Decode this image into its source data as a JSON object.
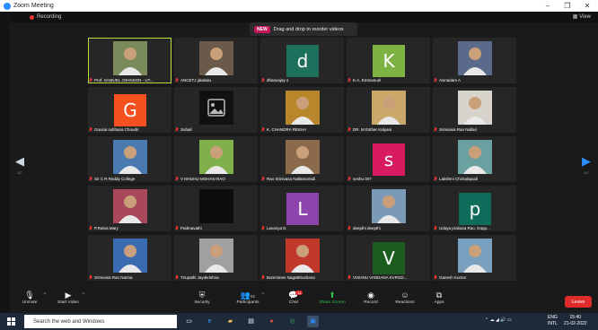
{
  "window": {
    "title": "Zoom Meeting"
  },
  "status": {
    "recording": "Recording",
    "view": "View"
  },
  "banner": {
    "badge": "NEW",
    "text": "Drag and drop to reorder videos"
  },
  "pager": {
    "left": "1/2",
    "right": "1/2"
  },
  "participants": [
    {
      "name": "Prof. SAMUEL JOHNSON - UT...",
      "type": "photo",
      "active": true,
      "color": "#7a8a5a"
    },
    {
      "name": "ANCETJ jalakalu",
      "type": "photo",
      "color": "#6b5a4a"
    },
    {
      "name": "dhanunjay s",
      "type": "letter",
      "letter": "d",
      "color": "#1e6f5c"
    },
    {
      "name": "K.A. Emmanuel",
      "type": "letter",
      "letter": "K",
      "color": "#7cb342"
    },
    {
      "name": "Asinadam A",
      "type": "photo",
      "color": "#5a6a8a"
    },
    {
      "name": "Gousia sulthana Choudri",
      "type": "letter",
      "letter": "G",
      "color": "#f4511e"
    },
    {
      "name": "Suhail",
      "type": "image-icon",
      "color": "#111111"
    },
    {
      "name": "K. CHANDRA REKHA",
      "type": "photo",
      "color": "#b8862b"
    },
    {
      "name": "DR. M Esther Kalyani",
      "type": "photo",
      "color": "#c9a86a"
    },
    {
      "name": "Srinivasa Rao Nallari",
      "type": "photo",
      "color": "#d7d2cc"
    },
    {
      "name": "Sir C R Reddy College",
      "type": "photo",
      "color": "#4a7ab0"
    },
    {
      "name": "V MADHU MOHAN RAO",
      "type": "photo",
      "color": "#7fb04a"
    },
    {
      "name": "Rao Srinivasa Nallamamidi",
      "type": "photo",
      "color": "#8a6a4a"
    },
    {
      "name": "seshu 007",
      "type": "letter",
      "letter": "s",
      "color": "#d81b60"
    },
    {
      "name": "Lakshmi Chintalapudi",
      "type": "photo",
      "color": "#6aa0a0"
    },
    {
      "name": "P.Ratna Mary",
      "type": "photo",
      "color": "#a8485a"
    },
    {
      "name": "Padmavathi",
      "type": "blank",
      "color": "#0d0d0d"
    },
    {
      "name": "Lavanya D",
      "type": "letter",
      "letter": "L",
      "color": "#8e44ad"
    },
    {
      "name": "deepthi deepthi",
      "type": "photo",
      "color": "#7a9ab8"
    },
    {
      "name": "Udaya prakasa Rao. Dopp...",
      "type": "letter",
      "letter": "p",
      "color": "#0f6b5a"
    },
    {
      "name": "Srinivasa Rao Narina",
      "type": "photo",
      "color": "#3a6ab0"
    },
    {
      "name": "Tirupathi Jayakrishna",
      "type": "photo",
      "color": "#a0a0a0"
    },
    {
      "name": "Bomminen NagaBhushana",
      "type": "photo",
      "color": "#c0392b"
    },
    {
      "name": "VISHNU VANDANA KVRGD...",
      "type": "letter",
      "letter": "V",
      "color": "#1b5e20"
    },
    {
      "name": "Ganesh Kumar",
      "type": "photo",
      "color": "#7aa0c0"
    }
  ],
  "toolbar": {
    "unmute": "Unmute",
    "start_video": "Start Video",
    "security": "Security",
    "participants": "Participants",
    "participants_count": "51",
    "chat": "Chat",
    "chat_badge": "14",
    "share_screen": "Share Screen",
    "record": "Record",
    "reactions": "Reactions",
    "apps": "Apps",
    "leave": "Leave"
  },
  "taskbar": {
    "search_placeholder": "Search the web and Windows",
    "lang": "ENG",
    "locale": "INTL",
    "time": "15:40",
    "date": "21-02-2022"
  }
}
